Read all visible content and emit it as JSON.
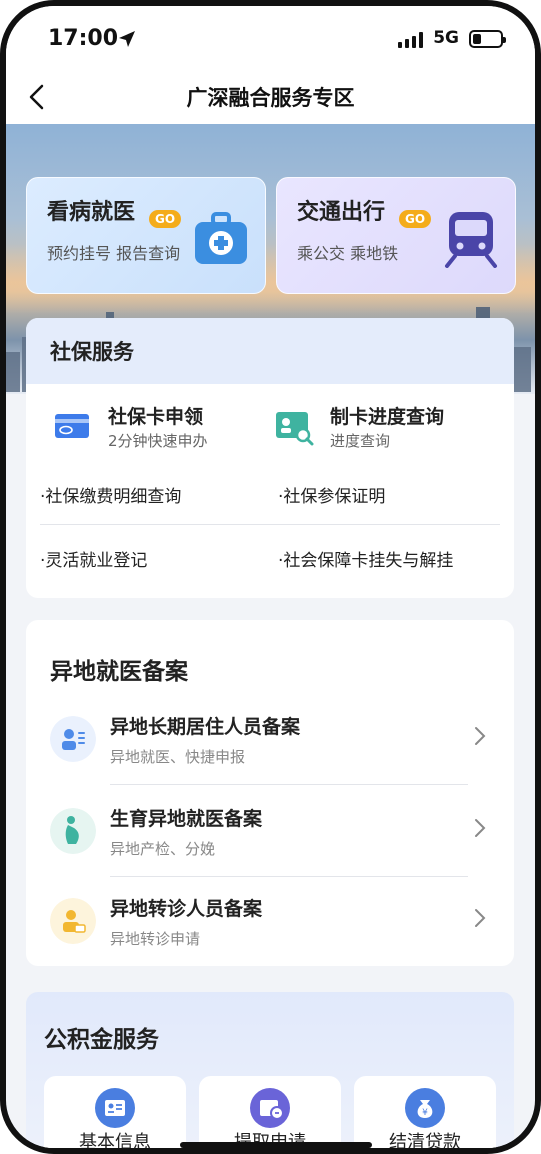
{
  "status_bar": {
    "time": "17:00",
    "network": "5G"
  },
  "nav": {
    "title": "广深融合服务专区"
  },
  "quick_cards": [
    {
      "title": "看病就医",
      "badge": "GO",
      "subtitle": "预约挂号 报告查询",
      "icon": "medical-kit-icon"
    },
    {
      "title": "交通出行",
      "badge": "GO",
      "subtitle": "乘公交 乘地铁",
      "icon": "train-icon"
    }
  ],
  "social_security": {
    "title": "社保服务",
    "features": [
      {
        "title": "社保卡申领",
        "subtitle": "2分钟快速申办",
        "icon": "card-icon"
      },
      {
        "title": "制卡进度查询",
        "subtitle": "进度查询",
        "icon": "id-card-search-icon"
      }
    ],
    "links": [
      "·社保缴费明细查询",
      "·社保参保证明",
      "·灵活就业登记",
      "·社会保障卡挂失与解挂"
    ]
  },
  "remote_medical": {
    "title": "异地就医备案",
    "items": [
      {
        "title": "异地长期居住人员备案",
        "subtitle": "异地就医、快捷申报",
        "icon": "resident-icon"
      },
      {
        "title": "生育异地就医备案",
        "subtitle": "异地产检、分娩",
        "icon": "pregnancy-icon"
      },
      {
        "title": "异地转诊人员备案",
        "subtitle": "异地转诊申请",
        "icon": "referral-icon"
      }
    ]
  },
  "housing_fund": {
    "title": "公积金服务",
    "tiles": [
      {
        "label": "基本信息",
        "icon": "info-card-icon"
      },
      {
        "label": "提取申请",
        "icon": "wallet-icon"
      },
      {
        "label": "结清贷款",
        "icon": "money-bag-icon"
      }
    ]
  },
  "colors": {
    "accent_blue": "#3d7bea",
    "badge_orange": "#f4ac1b",
    "teal": "#3fb3a0"
  }
}
